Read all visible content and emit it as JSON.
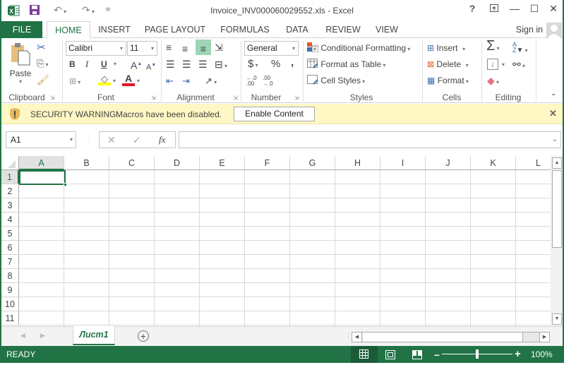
{
  "window": {
    "title": "Invoice_INV000060029552.xls - Excel",
    "app_icon": "excel-icon",
    "quick_access": {
      "save_icon": "save-icon",
      "undo_icon": "undo-icon",
      "redo_icon": "redo-icon",
      "customize_icon": "customize-qat-icon"
    },
    "controls": {
      "help": "?",
      "restore_ribbon": "▣",
      "minimize": "—",
      "maximize": "☐",
      "close": "✕"
    }
  },
  "tabs": {
    "file": "FILE",
    "items": [
      "HOME",
      "INSERT",
      "PAGE LAYOUT",
      "FORMULAS",
      "DATA",
      "REVIEW",
      "VIEW"
    ],
    "active": "HOME",
    "sign_in": "Sign in"
  },
  "ribbon": {
    "clipboard": {
      "label": "Clipboard",
      "paste": "Paste"
    },
    "font": {
      "label": "Font",
      "font_name": "Calibri",
      "font_size": "11",
      "bold": "B",
      "italic": "I",
      "underline": "U",
      "grow": "A",
      "shrink": "A",
      "font_color_hex": "#e81123",
      "highlight_hex": "#ffff00"
    },
    "alignment": {
      "label": "Alignment"
    },
    "number": {
      "label": "Number",
      "format": "General",
      "currency": "$",
      "percent": "%",
      "comma": ",",
      "inc_decimal": "←.0 .00",
      "dec_decimal": ".00 →.0"
    },
    "styles": {
      "label": "Styles",
      "conditional": "Conditional Formatting",
      "format_table": "Format as Table",
      "cell_styles": "Cell Styles"
    },
    "cells": {
      "label": "Cells",
      "insert": "Insert",
      "delete": "Delete",
      "format": "Format"
    },
    "editing": {
      "label": "Editing",
      "autosum": "Σ",
      "sort": "A/Z",
      "find": "find-icon"
    }
  },
  "security_warning": {
    "title": "SECURITY WARNING",
    "message": "Macros have been disabled.",
    "button": "Enable Content",
    "close": "✕"
  },
  "formula_bar": {
    "name_box": "A1",
    "cancel": "✕",
    "enter": "✓",
    "fx": "fx",
    "formula": ""
  },
  "grid": {
    "columns": [
      "A",
      "B",
      "C",
      "D",
      "E",
      "F",
      "G",
      "H",
      "I",
      "J",
      "K",
      "L"
    ],
    "rows": [
      "1",
      "2",
      "3",
      "4",
      "5",
      "6",
      "7",
      "8",
      "9",
      "10",
      "11"
    ],
    "selected_cell": "A1"
  },
  "sheets": {
    "tabs": [
      "Лист1"
    ],
    "active": "Лист1",
    "add": "+"
  },
  "status_bar": {
    "status": "READY",
    "zoom": "100%",
    "zoom_level_percent": 100,
    "accent_hex": "#217346"
  }
}
